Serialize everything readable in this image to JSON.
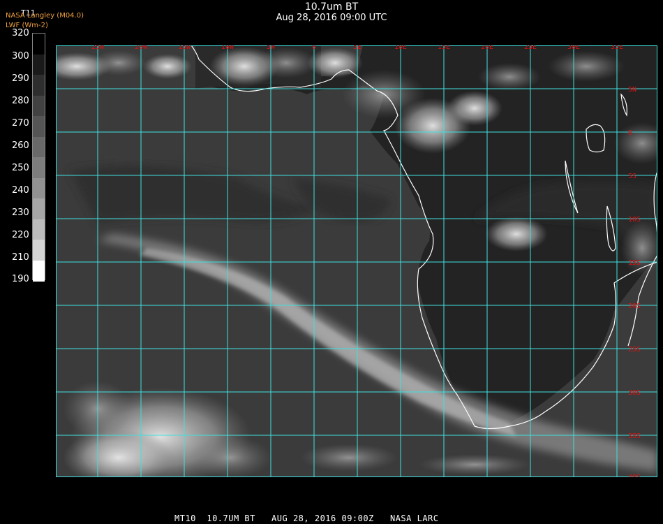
{
  "header": {
    "title": "10.7um BT",
    "subtitle": "Aug 28, 2016 09:00 UTC"
  },
  "legend": {
    "title": "T11",
    "credit": "NASA Langley (M04.0)",
    "unit_label": "LWF (Wm-2)",
    "ticks": [
      "320",
      "300",
      "290",
      "280",
      "270",
      "260",
      "250",
      "240",
      "230",
      "220",
      "210",
      "190"
    ],
    "colors": [
      "#000000",
      "#1a1a1a",
      "#2e2e2e",
      "#424242",
      "#555555",
      "#696969",
      "#7d7d7d",
      "#919191",
      "#a6a6a6",
      "#bcbcbc",
      "#d4d4d4",
      "#ffffff"
    ]
  },
  "map": {
    "grid_color": "#40e0e0",
    "coast_color": "#ffffff",
    "label_color": "#e01010",
    "lon_labels": [
      "25W",
      "20W",
      "15W",
      "10W",
      "5W",
      "0",
      "5E",
      "10E",
      "15E",
      "20E",
      "25E",
      "30E",
      "35E"
    ],
    "lat_labels": [
      "5N",
      "0",
      "5S",
      "10S",
      "15S",
      "20S",
      "25S",
      "30S",
      "35S",
      "40S"
    ]
  },
  "footer": {
    "text": "MT10  10.7UM BT   AUG 28, 2016 09:00Z   NASA LARC"
  }
}
